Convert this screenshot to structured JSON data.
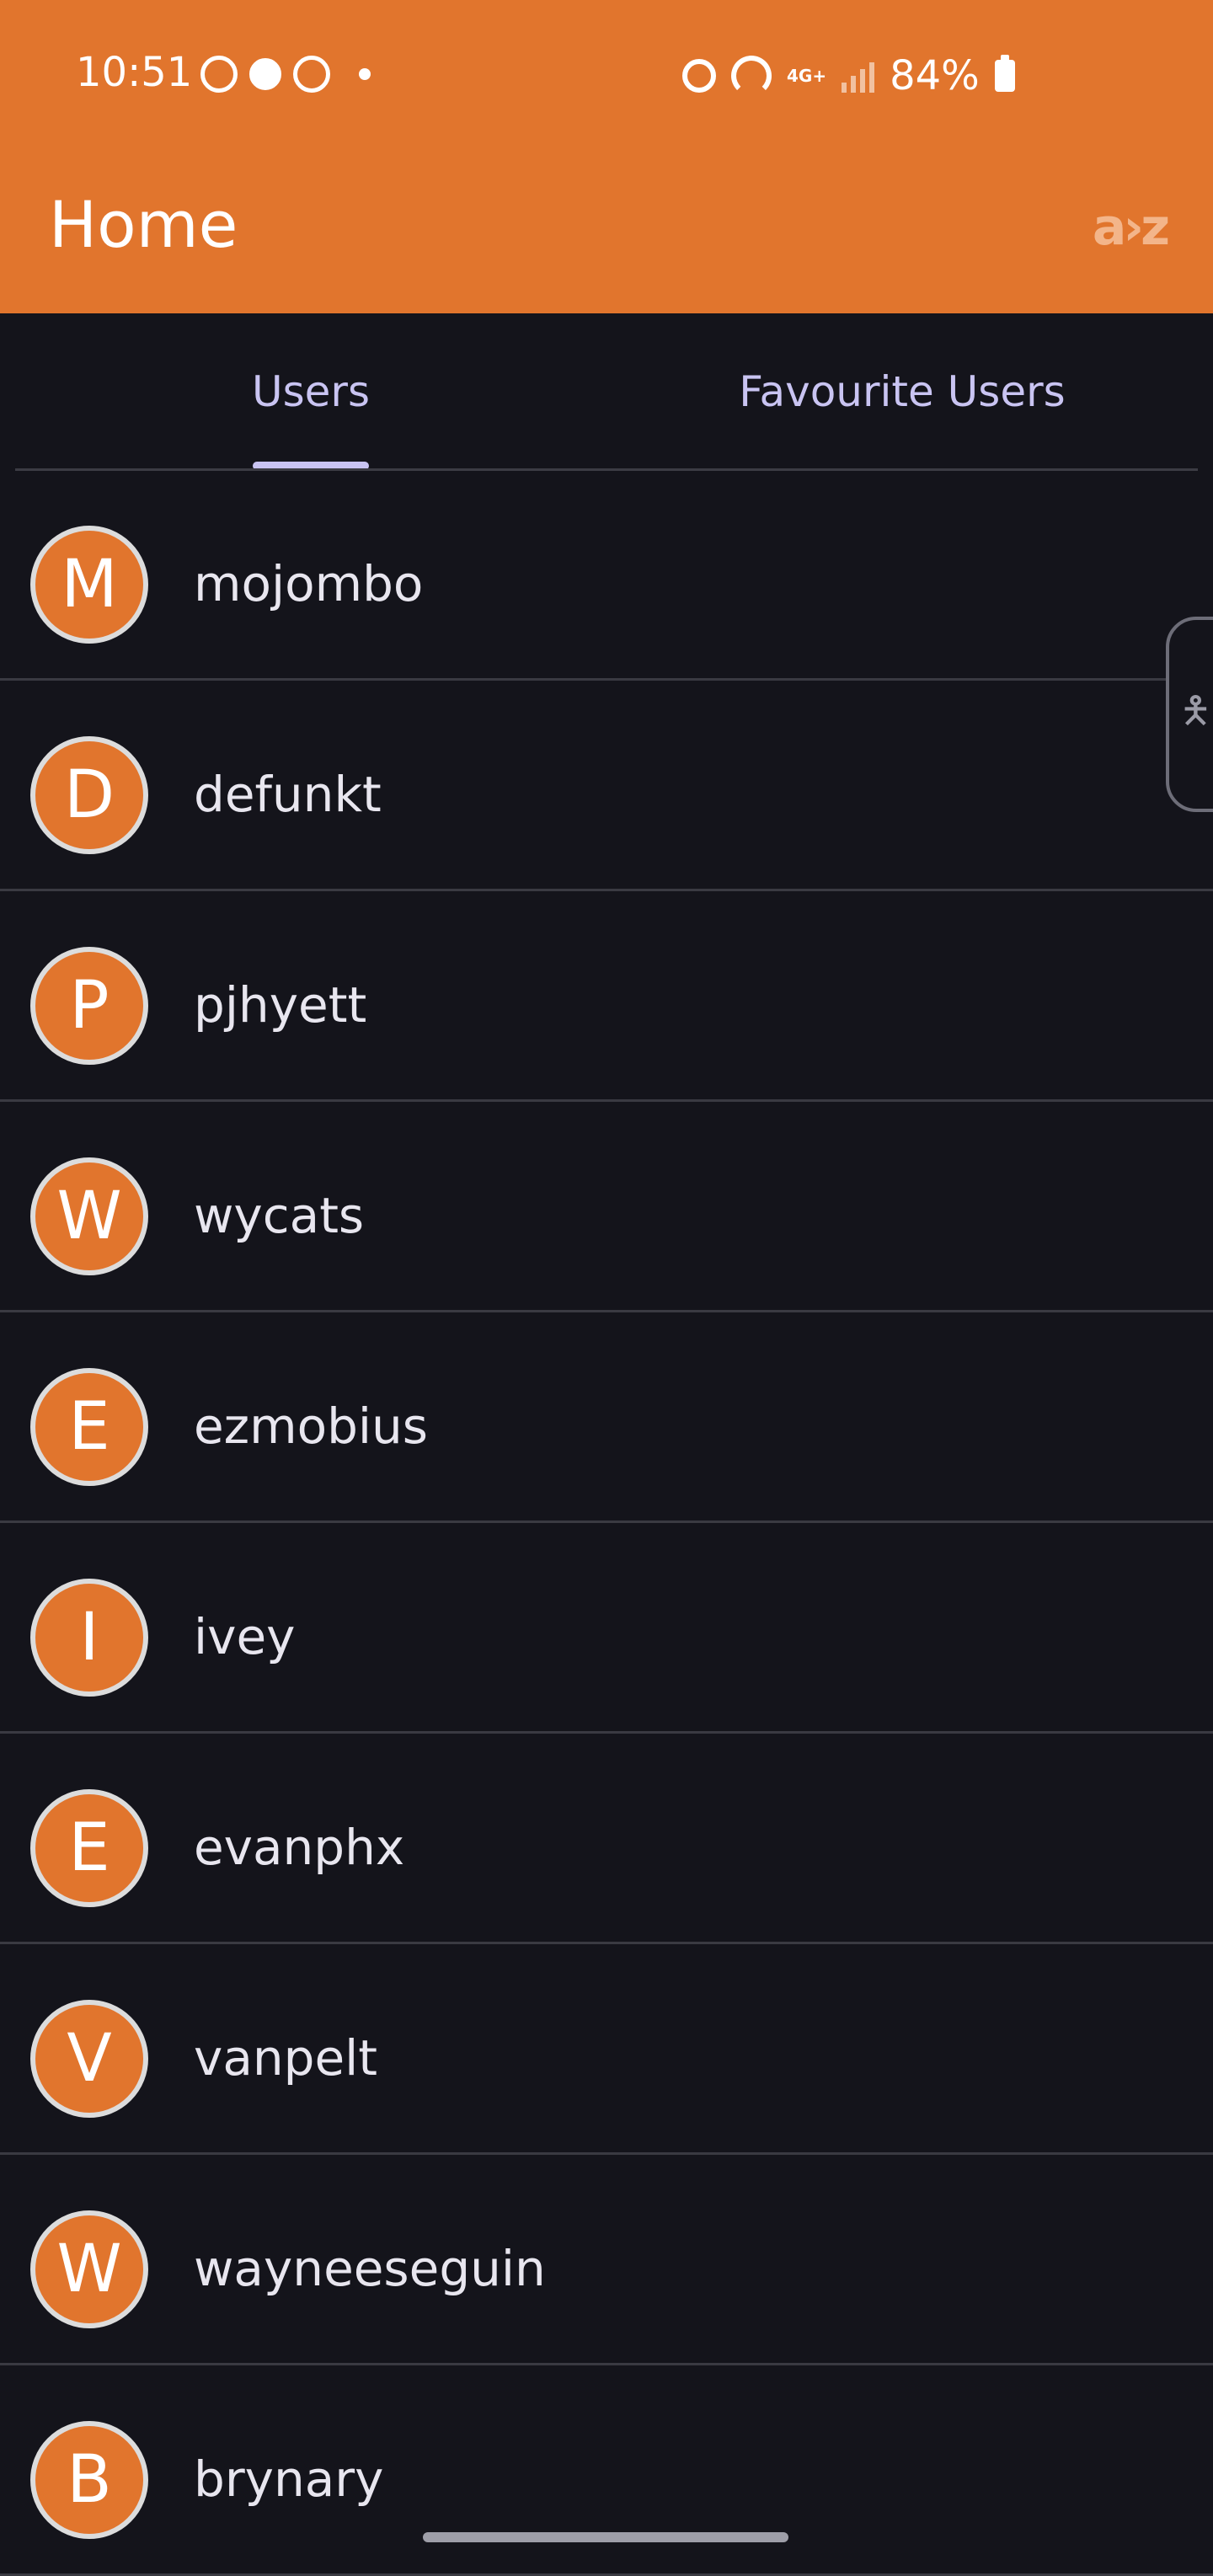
{
  "status_bar": {
    "time": "10:51",
    "network": "4G+",
    "battery": "84%",
    "icons_left": [
      "whatsapp-icon",
      "notification-icon",
      "app-icon",
      "dot-icon"
    ],
    "icons_right": [
      "alarm-icon",
      "hotspot-icon",
      "network-4g-icon",
      "signal-icon",
      "battery-icon"
    ]
  },
  "app_bar": {
    "title": "Home",
    "sort_label": "a›z",
    "background": "#e1752d"
  },
  "tabs": [
    {
      "label": "Users",
      "selected": true
    },
    {
      "label": "Favourite Users",
      "selected": false
    }
  ],
  "users": [
    {
      "initial": "M",
      "name": "mojombo"
    },
    {
      "initial": "D",
      "name": "defunkt"
    },
    {
      "initial": "P",
      "name": "pjhyett"
    },
    {
      "initial": "W",
      "name": "wycats"
    },
    {
      "initial": "E",
      "name": "ezmobius"
    },
    {
      "initial": "I",
      "name": "ivey"
    },
    {
      "initial": "E",
      "name": "evanphx"
    },
    {
      "initial": "V",
      "name": "vanpelt"
    },
    {
      "initial": "W",
      "name": "wayneeseguin"
    },
    {
      "initial": "B",
      "name": "brynary"
    }
  ],
  "accessibility_tab": {
    "icon": "accessibility-icon",
    "glyph": "🯅"
  },
  "colors": {
    "accent": "#e1752d",
    "background": "#14141b",
    "tab_text": "#c9c4f2"
  }
}
